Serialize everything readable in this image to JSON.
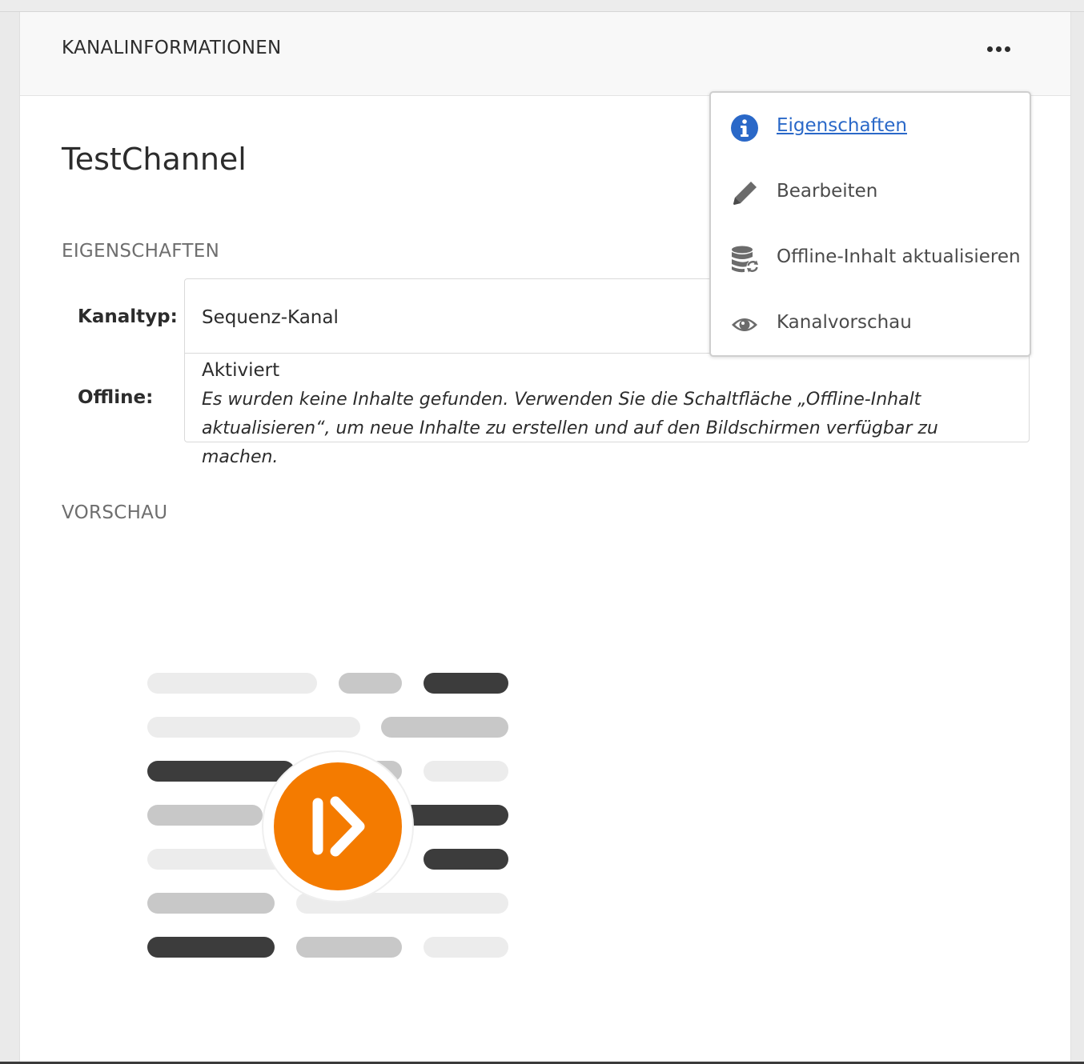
{
  "card": {
    "title": "KANALINFORMATIONEN",
    "more_icon": "more-horizontal-icon"
  },
  "channel": {
    "name": "TestChannel"
  },
  "properties": {
    "heading": "EIGENSCHAFTEN",
    "rows": [
      {
        "label": "Kanaltyp:",
        "value": "Sequenz-Kanal"
      },
      {
        "label": "Offline:",
        "value": "Aktiviert",
        "note": "Es wurden keine Inhalte gefunden. Verwenden Sie die Schaltfläche „Offline-Inhalt aktualisieren“, um neue Inhalte zu erstellen und auf den Bildschirmen verfügbar zu machen."
      }
    ]
  },
  "preview": {
    "heading": "VORSCHAU",
    "illustration_icon": "sequence-channel-play-icon",
    "accent": "#f47b00"
  },
  "menu": {
    "items": [
      {
        "label": "Eigenschaften",
        "icon": "info-icon",
        "active": true
      },
      {
        "label": "Bearbeiten",
        "icon": "pencil-icon"
      },
      {
        "label": "Offline-Inhalt aktualisieren",
        "icon": "database-refresh-icon"
      },
      {
        "label": "Kanalvorschau",
        "icon": "eye-icon"
      }
    ],
    "link_color": "#2a68c8",
    "info_color": "#2a68c8"
  }
}
